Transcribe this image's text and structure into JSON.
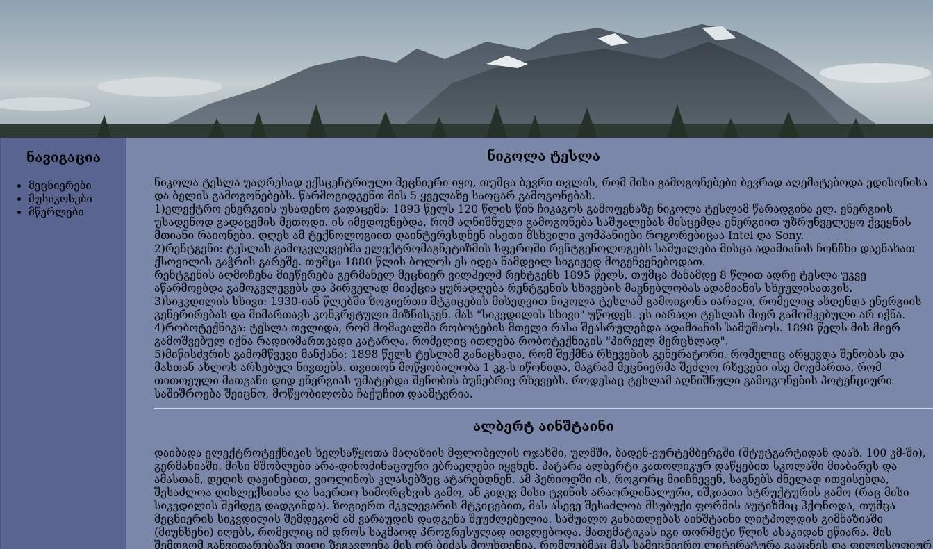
{
  "sidebar": {
    "title": "ნავიგაცია",
    "items": [
      {
        "label": "მეცნიერები"
      },
      {
        "label": "მუსიკოსები"
      },
      {
        "label": "მწერლები"
      }
    ]
  },
  "articles": [
    {
      "title": "ნიკოლა ტესლა",
      "paragraphs": [
        "ნიკოლა ტესლა უაღრესად ექსცენტრიული მეცნიერი იყო, თუმცა ბევრი თვლის, რომ მისი გამოგონებები ბევრად აღემატებოდა ედისონისა და ბელის გამოგონებებს. წარმოგიდგენთ მის 5 ყველაზე საოცარ გამოგონებას.",
        "1)ელექტრო ენერგიის უსადენო გადაცემა: 1893 წელს 120 წლის წინ ჩიკაგოს გამოფენაზე ნიკოლა ტესლამ წარადგინა ელ. ენერგიის უსადენოდ გადაცემის მეთოდი. ის იმედოვნებდა, რომ აღნიშნული გამოგონება საშუალებას მისცემდა ენერგიით უზრუნველეყო ქვეყნის მთიანი რაიონები. დღეს ამ ტექნოლოგიით დაინტერესდნენ ისეთი მსხვილი კომპანიები როგორებიცაა Intel და Sony.",
        "2)რენტგენი: ტესლას გამოკვლევებმა ელექტრომაგნეტიზმის სფეროში რენტგენოლოგებს საშუალება მისცა ადამიანის ჩონჩხი დაენახათ ქსოვილის გაჭრის გარეშე. თუმცა 1880 წლის ბოლოს ეს იდეა ნამდვილ სიგიჟედ მოგეჩვენებოდათ.",
        "რენტგენის აღმოჩენა მიეწერება გერმანელ მეცნიერ ვილჰელმ რენტგენს 1895 წელს, თუმცა მანამდე 8 წლით ადრე ტესლა უკვე აწარმოებდა გამოკვლევებს და პირველად მიაქცია ყურადღება რენტგენის სხივების მავნებლობას ადამიანის სხეულისათვის.",
        "3)სიკვდილის სხივი: 1930-იან წლებში ზოგიერთი მტკიცების მიხედვით ნიკოლა ტესლამ გამოიგონა იარაღი, რომელიც ახდენდა ენერგიის გენერირებას და მიმართავს კონკრეტული მიზნისკენ. მას \"სიკვდილის სხივი\" უწოდეს. ეს იარაღი ტესლას მიერ გამოშვებული არ იქნა.",
        "4)რობოტექნიკა: ტესლა თვლიდა, რომ მომავალში რობოტების მთელი რასა შეასრულებდა ადამიანის სამუშაოს. 1898 წელს მის მიერ გამოშვებულ იქნა რადიომართვადი კატარღა, რომელიც ითლება რობოტექნიკის \"პირველ მერცხლად\".",
        "5)მიწისძვრის გამომწვევი მანქანა: 1898 წელს ტესლამ განაცხადა, რომ შექმნა რხევების გენერატორი, რომელიც არყევდა შენობას და მასთან ახლოს არსებულ ნივთებს. თვითონ მოწყობილობა 1 კგ-ს იწონიდა, მაგრამ მეცნიერმა შეძლო რხევები ისე მოემართა, რომ თითოეული მათგანი დიდ ენერგიას უმატებდა შენობის ბუნებრივ რხევებს. როდესაც ტესლამ აღნიშნული გამოგონების პოტენციური საშიშროება შეიცნო, მოწყობილობა ჩაქუჩით დაამტვრია."
      ]
    },
    {
      "title": "ალბერტ აინშტაინი",
      "paragraphs": [
        "დაიბადა ელექტროტექნიკის ხელსაწყოთა მაღაზიის მფლობელის ოჯახში, ულმში, ბადენ-ვურტემბერგში (შტუტგარტიდან დაახ. 100 კმ-ში), გერმანიაში. მისი მშობლები არა-დინომინაციური ებრაელები იყვნენ. პატარა ალბერტი კათოლიკურ დაწყებით სკოლაში მიაბარეს და ამასთან, დედის დაჟინებით, ვიოლინოს კლასებზეც ატარებდნენ. ამ პერიოდში ის, როგორც მიიჩნევენ, საგნებს ძნელად ითვისებდა, შესაძლოა დისლექსიისა და საერთო სიმორცხვის გამო, ან კიდევ მისი ტვინის არაორდინალური, იშვიათი სტრუქტურის გამო (რაც მისი სიკვდილის შემდეგ დადგინდა). ზოგიერთ მკვლევარის მტკიცებით, მას ასევე შესაძლოა მსუბუქი ფორმის აუტიზმიც ჰქონოდა, თუმცა მეცნიერის სიკვდილის შემდეგომ ამ ვარაუდის დადგენა შეუძლებელია. საშუალო განათლებას აინშტაინი ლიტპოლდის გიმნაზიაში (მიუნხენი) იღებს, რომელიც იმ დროს საკმაოდ პროგრესულად ითვლებოდა. მათემატიკას იგი თორმეტი წლის ასაკიდან ეწიარა. მის შემდგომ განვითარებაზე დიდი ზეგავლენა მის ორ ბიძას მოუხდენია, რომლებმაც მას სამეცნიერო ლიტერატურა გააცნეს და ფილოსოფიურ წიგნებსაც აკითხებდნენ."
      ]
    }
  ]
}
